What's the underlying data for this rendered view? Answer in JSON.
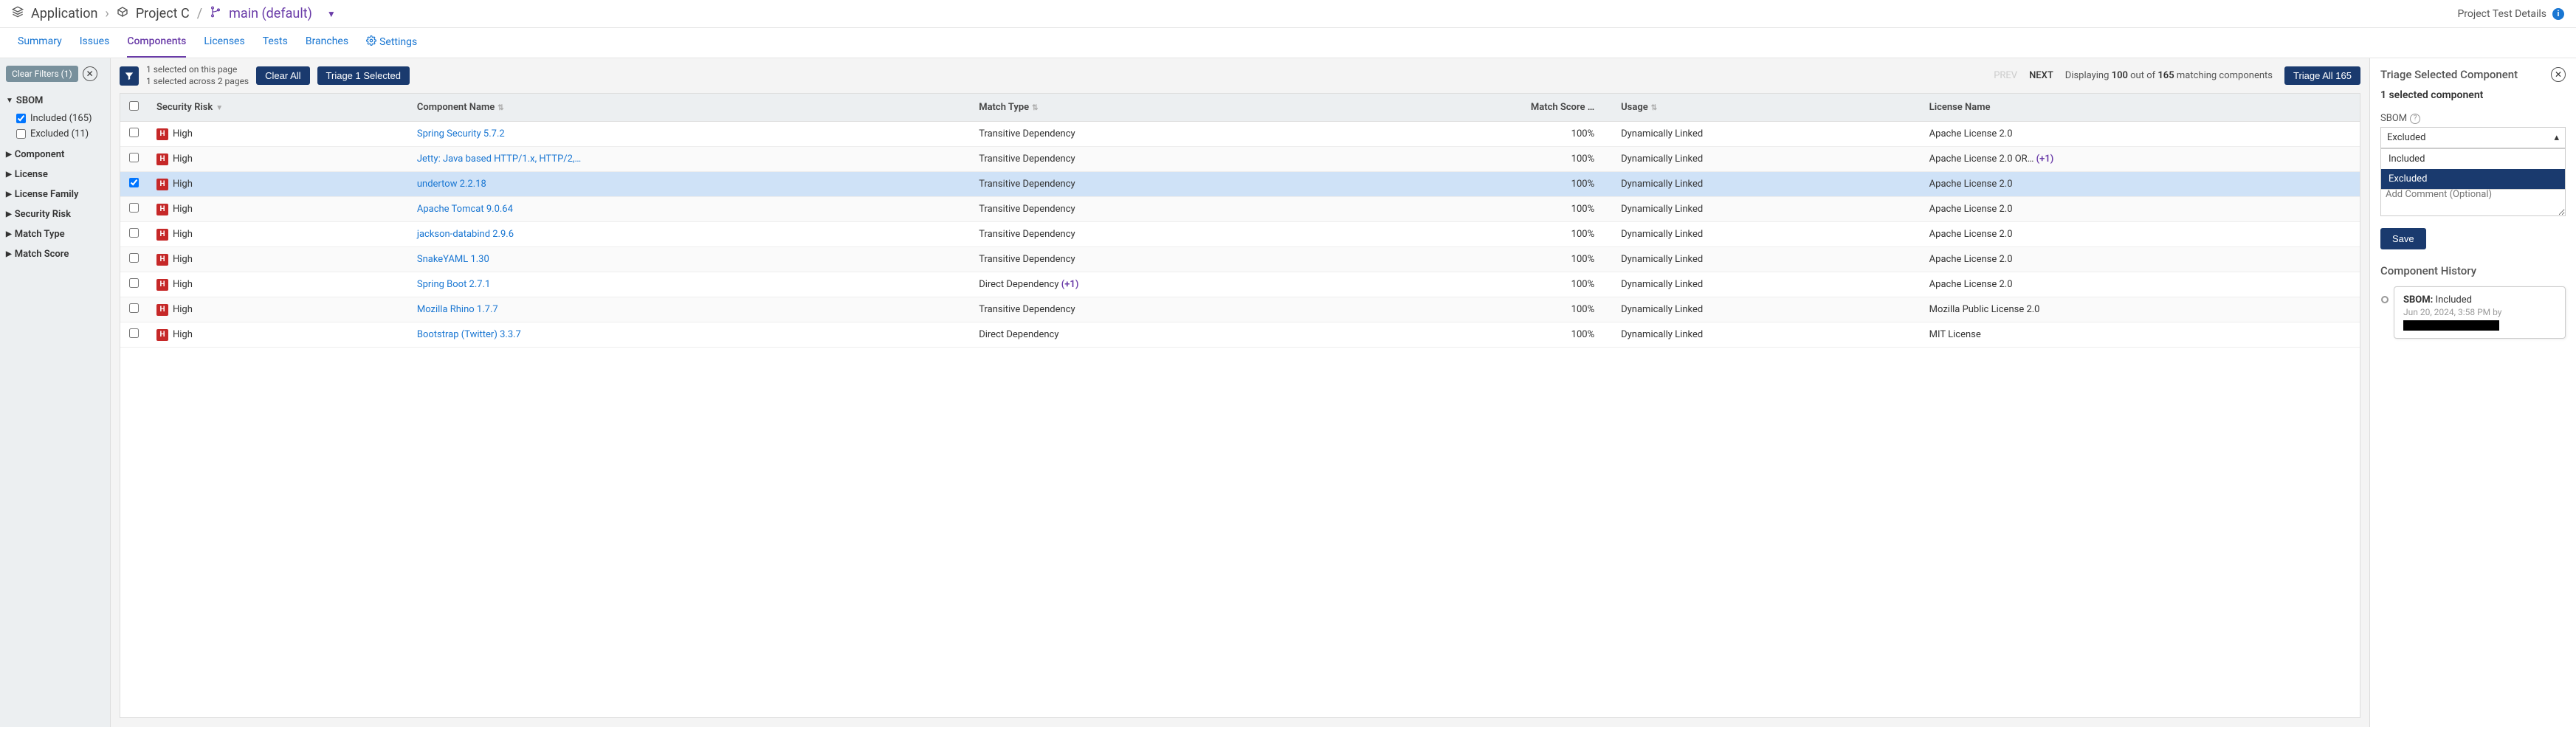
{
  "breadcrumb": {
    "app_label": "Application",
    "project_label": "Project C",
    "branch_label": "main (default)"
  },
  "header_right": {
    "details_label": "Project Test Details"
  },
  "tabs": {
    "summary": "Summary",
    "issues": "Issues",
    "components": "Components",
    "licenses": "Licenses",
    "tests": "Tests",
    "branches": "Branches",
    "settings": "Settings"
  },
  "filters": {
    "clear_label": "Clear Filters (1)",
    "sbom": {
      "heading": "SBOM",
      "included_label": "Included (165)",
      "excluded_label": "Excluded (11)",
      "included_checked": true,
      "excluded_checked": false
    },
    "component": "Component",
    "license": "License",
    "license_family": "License Family",
    "security_risk": "Security Risk",
    "match_type": "Match Type",
    "match_score": "Match Score"
  },
  "toolbar": {
    "selection_line1": "1 selected on this page",
    "selection_line2": "1 selected across 2 pages",
    "clear_all": "Clear All",
    "triage_selected": "Triage 1 Selected",
    "prev": "PREV",
    "next": "NEXT",
    "displaying_prefix": "Displaying ",
    "displaying_count": "100",
    "displaying_mid": " out of ",
    "displaying_total": "165",
    "displaying_suffix": " matching components",
    "triage_all": "Triage All 165"
  },
  "columns": {
    "risk": "Security Risk",
    "name": "Component Name",
    "match_type": "Match Type",
    "match_score": "Match Score …",
    "usage": "Usage",
    "license": "License Name"
  },
  "rows": [
    {
      "checked": false,
      "risk": "High",
      "name": "Spring Security 5.7.2",
      "match_type": "Transitive Dependency",
      "score": "100%",
      "usage": "Dynamically Linked",
      "license": "Apache License 2.0"
    },
    {
      "checked": false,
      "risk": "High",
      "name": "Jetty: Java based HTTP/1.x, HTTP/2,…",
      "match_type": "Transitive Dependency",
      "score": "100%",
      "usage": "Dynamically Linked",
      "license": "Apache License 2.0 OR…",
      "license_extra": "(+1)"
    },
    {
      "checked": true,
      "risk": "High",
      "name": "undertow 2.2.18",
      "match_type": "Transitive Dependency",
      "score": "100%",
      "usage": "Dynamically Linked",
      "license": "Apache License 2.0"
    },
    {
      "checked": false,
      "risk": "High",
      "name": "Apache Tomcat 9.0.64",
      "match_type": "Transitive Dependency",
      "score": "100%",
      "usage": "Dynamically Linked",
      "license": "Apache License 2.0"
    },
    {
      "checked": false,
      "risk": "High",
      "name": "jackson-databind 2.9.6",
      "match_type": "Transitive Dependency",
      "score": "100%",
      "usage": "Dynamically Linked",
      "license": "Apache License 2.0"
    },
    {
      "checked": false,
      "risk": "High",
      "name": "SnakeYAML 1.30",
      "match_type": "Transitive Dependency",
      "score": "100%",
      "usage": "Dynamically Linked",
      "license": "Apache License 2.0"
    },
    {
      "checked": false,
      "risk": "High",
      "name": "Spring Boot 2.7.1",
      "match_type": "Direct Dependency",
      "match_extra": "(+1)",
      "score": "100%",
      "usage": "Dynamically Linked",
      "license": "Apache License 2.0"
    },
    {
      "checked": false,
      "risk": "High",
      "name": "Mozilla Rhino 1.7.7",
      "match_type": "Transitive Dependency",
      "score": "100%",
      "usage": "Dynamically Linked",
      "license": "Mozilla Public License 2.0"
    },
    {
      "checked": false,
      "risk": "High",
      "name": "Bootstrap (Twitter) 3.3.7",
      "match_type": "Direct Dependency",
      "score": "100%",
      "usage": "Dynamically Linked",
      "license": "MIT License"
    }
  ],
  "triage": {
    "title": "Triage Selected Component",
    "count_num": "1",
    "count_suffix": " selected component",
    "sbom_label": "SBOM",
    "select_value": "Excluded",
    "dropdown": {
      "included": "Included",
      "excluded": "Excluded"
    },
    "comment_placeholder": "Add Comment (Optional)",
    "save": "Save",
    "history_title": "Component History",
    "history_item": {
      "label": "SBOM:",
      "value": "Included",
      "meta": "Jun 20, 2024, 3:58 PM by"
    }
  }
}
